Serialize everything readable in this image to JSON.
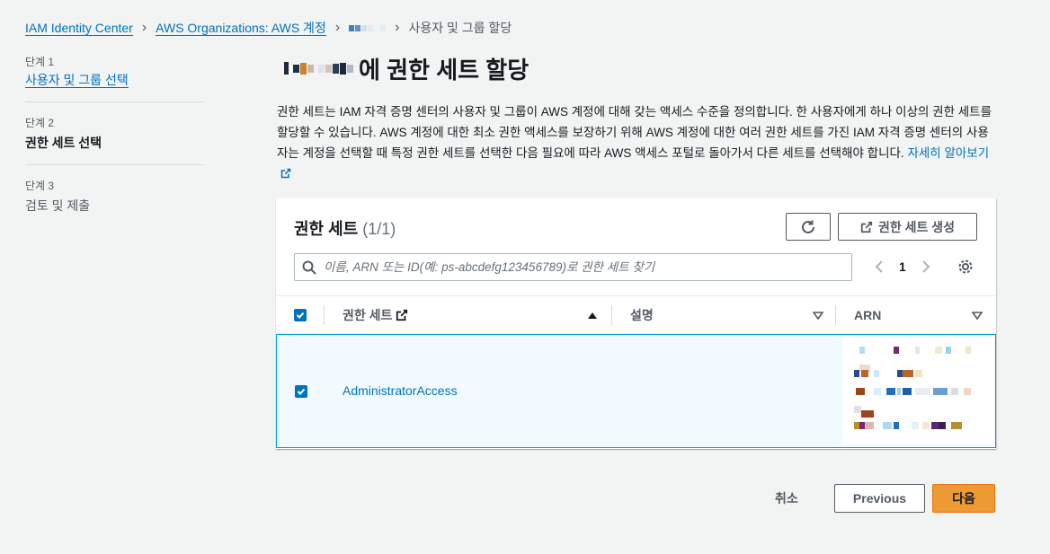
{
  "breadcrumb": {
    "items": [
      "IAM Identity Center",
      "AWS Organizations: AWS 계정"
    ],
    "current": "사용자 및 그룹 할당"
  },
  "steps": [
    {
      "num": "단계 1",
      "title": "사용자 및 그룹 선택"
    },
    {
      "num": "단계 2",
      "title": "권한 세트 선택"
    },
    {
      "num": "단계 3",
      "title": "검토 및 제출"
    }
  ],
  "page": {
    "title_suffix": "에 권한 세트 할당",
    "description": "권한 세트는 IAM 자격 증명 센터의 사용자 및 그룹이 AWS 계정에 대해 갖는 액세스 수준을 정의합니다. 한 사용자에게 하나 이상의 권한 세트를 할당할 수 있습니다. AWS 계정에 대한 최소 권한 액세스를 보장하기 위해 AWS 계정에 대한 여러 권한 세트를 가진 IAM 자격 증명 센터의 사용자는 계정을 선택할 때 특정 권한 세트를 선택한 다음 필요에 따라 AWS 액세스 포털로 돌아가서 다른 세트를 선택해야 합니다.",
    "learn_more": "자세히 알아보기"
  },
  "panel": {
    "title": "권한 세트",
    "count": "(1/1)",
    "create_label": "권한 세트 생성",
    "search_placeholder": "이름, ARN 또는 ID(예: ps-abcdefg123456789)로 권한 세트 찾기",
    "page_number": "1",
    "columns": [
      "권한 세트",
      "설명",
      "ARN"
    ],
    "rows": [
      {
        "name": "AdministratorAccess",
        "description": "",
        "selected": true
      }
    ]
  },
  "footer": {
    "cancel": "취소",
    "previous": "Previous",
    "next": "다음"
  },
  "colors": {
    "link": "#0073bb",
    "primary_button": "#ec9a34",
    "selected_row": "#f1faff"
  }
}
